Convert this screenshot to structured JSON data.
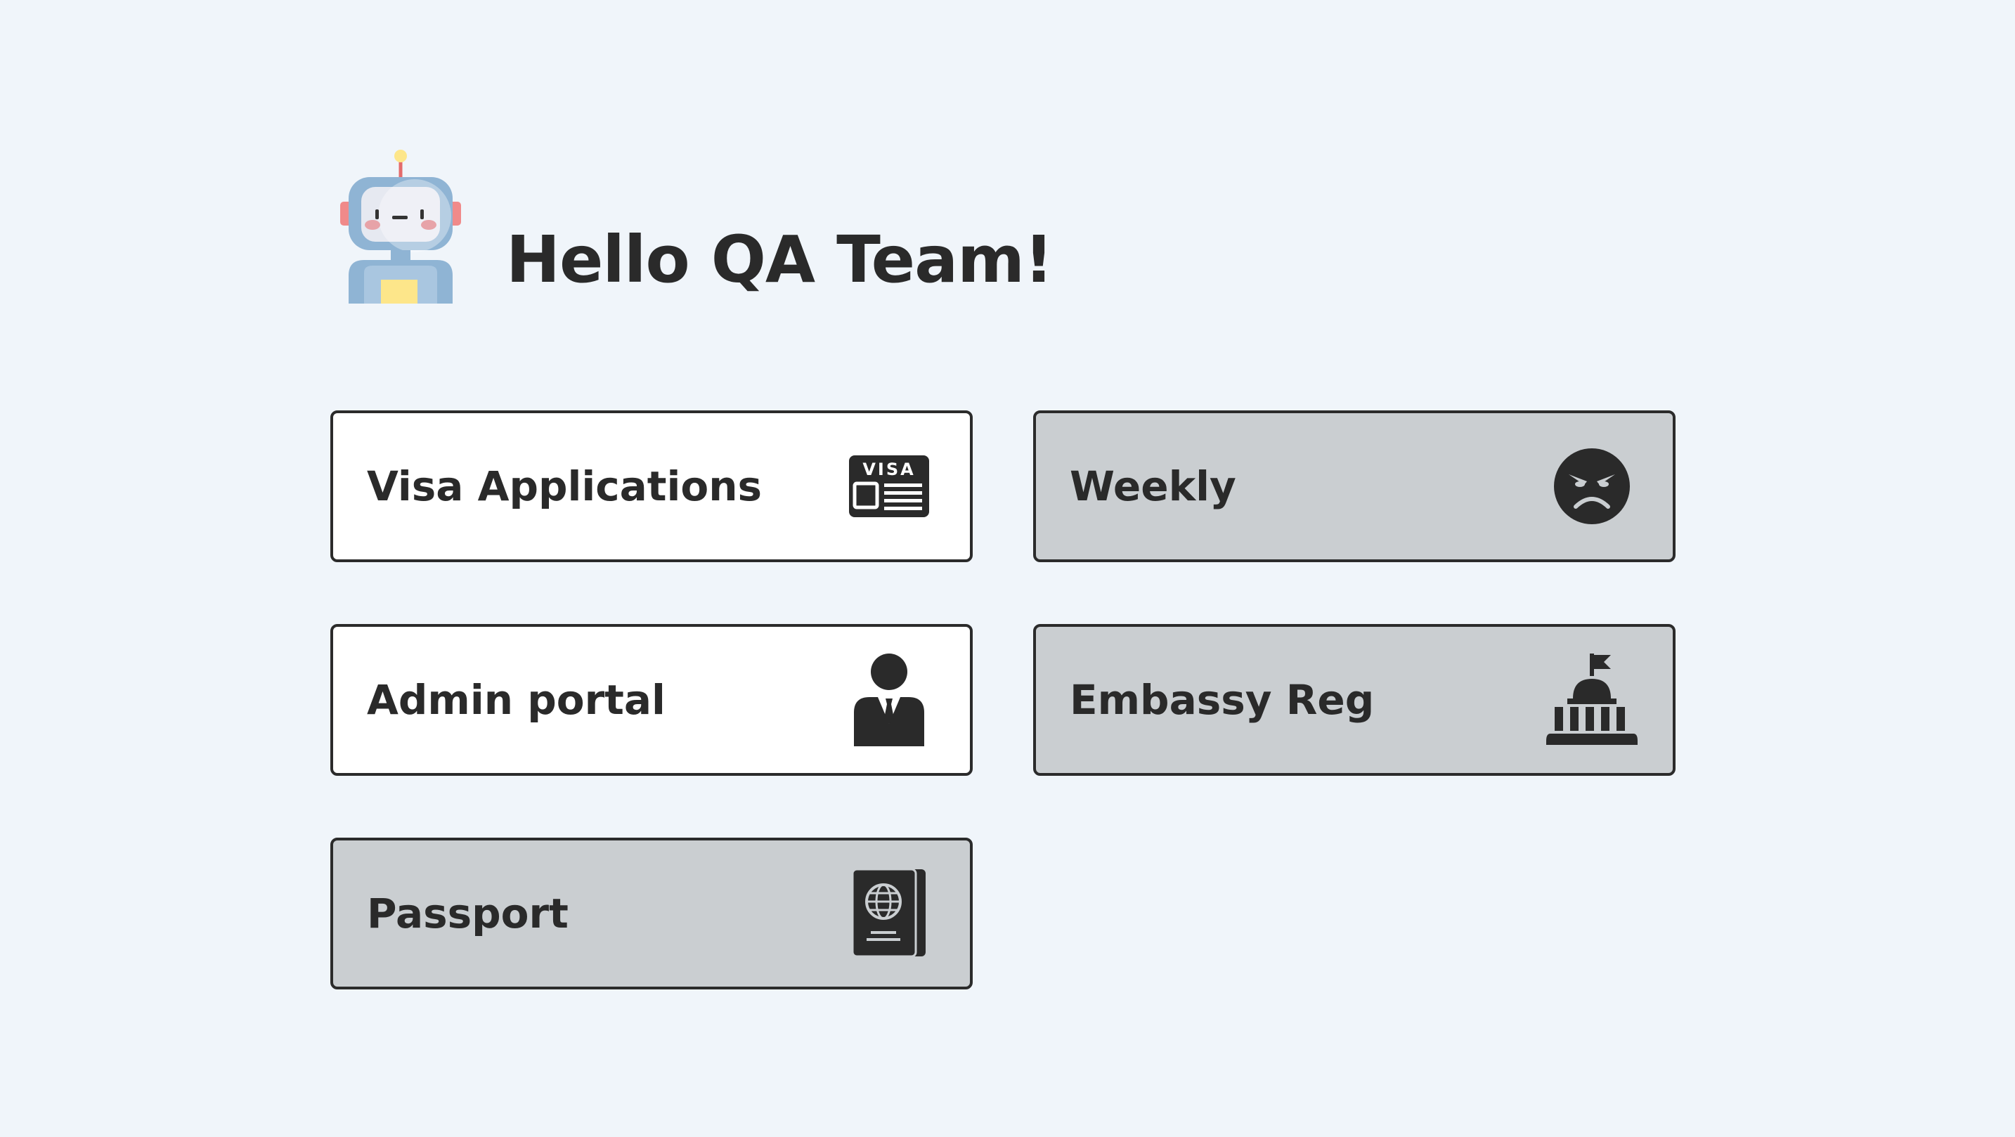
{
  "header": {
    "greeting": "Hello QA Team!",
    "mascot_icon": "robot-icon"
  },
  "tiles": [
    {
      "label": "Visa Applications",
      "icon": "visa-card-icon",
      "style": "light",
      "icon_text": "VISA"
    },
    {
      "label": "Weekly",
      "icon": "angry-face-icon",
      "style": "dark"
    },
    {
      "label": "Admin portal",
      "icon": "businessman-icon",
      "style": "light"
    },
    {
      "label": "Embassy Reg",
      "icon": "embassy-building-icon",
      "style": "dark"
    },
    {
      "label": "Passport",
      "icon": "passport-icon",
      "style": "dark"
    }
  ],
  "colors": {
    "background": "#f0f5fa",
    "tile_light": "#ffffff",
    "tile_dark": "#caced1",
    "border": "#2b2b2b",
    "text": "#2a2a2a"
  }
}
